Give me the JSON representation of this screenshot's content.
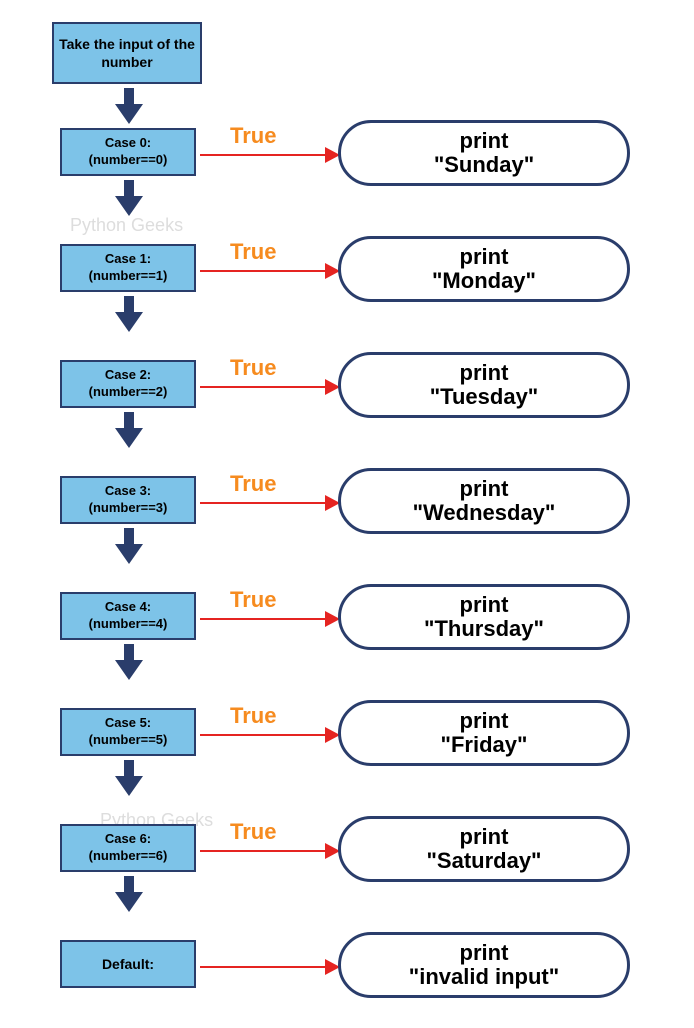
{
  "input": {
    "text": "Take the input of the number"
  },
  "cases": [
    {
      "label": "Case 0:",
      "condition": "(number==0)",
      "true_text": "True",
      "output_line1": "print",
      "output_line2": "\"Sunday\""
    },
    {
      "label": "Case 1:",
      "condition": "(number==1)",
      "true_text": "True",
      "output_line1": "print",
      "output_line2": "\"Monday\""
    },
    {
      "label": "Case 2:",
      "condition": "(number==2)",
      "true_text": "True",
      "output_line1": "print",
      "output_line2": "\"Tuesday\""
    },
    {
      "label": "Case 3:",
      "condition": "(number==3)",
      "true_text": "True",
      "output_line1": "print",
      "output_line2": "\"Wednesday\""
    },
    {
      "label": "Case 4:",
      "condition": "(number==4)",
      "true_text": "True",
      "output_line1": "print",
      "output_line2": "\"Thursday\""
    },
    {
      "label": "Case 5:",
      "condition": "(number==5)",
      "true_text": "True",
      "output_line1": "print",
      "output_line2": "\"Friday\""
    },
    {
      "label": "Case 6:",
      "condition": "(number==6)",
      "true_text": "True",
      "output_line1": "print",
      "output_line2": "\"Saturday\""
    }
  ],
  "default": {
    "label": "Default:",
    "output_line1": "print",
    "output_line2": "\"invalid input\""
  },
  "watermark": "Python Geeks"
}
